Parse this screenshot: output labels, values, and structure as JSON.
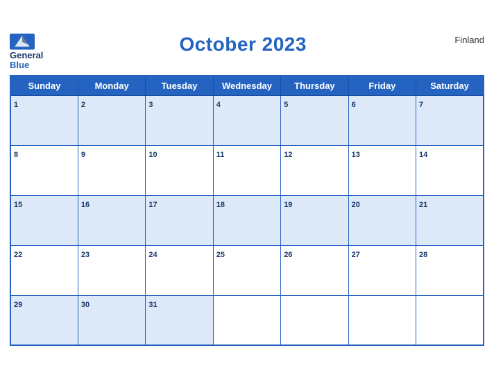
{
  "header": {
    "logo_general": "General",
    "logo_blue": "Blue",
    "title": "October 2023",
    "country": "Finland"
  },
  "weekdays": [
    "Sunday",
    "Monday",
    "Tuesday",
    "Wednesday",
    "Thursday",
    "Friday",
    "Saturday"
  ],
  "weeks": [
    [
      {
        "day": "1",
        "empty": false
      },
      {
        "day": "2",
        "empty": false
      },
      {
        "day": "3",
        "empty": false
      },
      {
        "day": "4",
        "empty": false
      },
      {
        "day": "5",
        "empty": false
      },
      {
        "day": "6",
        "empty": false
      },
      {
        "day": "7",
        "empty": false
      }
    ],
    [
      {
        "day": "8",
        "empty": false
      },
      {
        "day": "9",
        "empty": false
      },
      {
        "day": "10",
        "empty": false
      },
      {
        "day": "11",
        "empty": false
      },
      {
        "day": "12",
        "empty": false
      },
      {
        "day": "13",
        "empty": false
      },
      {
        "day": "14",
        "empty": false
      }
    ],
    [
      {
        "day": "15",
        "empty": false
      },
      {
        "day": "16",
        "empty": false
      },
      {
        "day": "17",
        "empty": false
      },
      {
        "day": "18",
        "empty": false
      },
      {
        "day": "19",
        "empty": false
      },
      {
        "day": "20",
        "empty": false
      },
      {
        "day": "21",
        "empty": false
      }
    ],
    [
      {
        "day": "22",
        "empty": false
      },
      {
        "day": "23",
        "empty": false
      },
      {
        "day": "24",
        "empty": false
      },
      {
        "day": "25",
        "empty": false
      },
      {
        "day": "26",
        "empty": false
      },
      {
        "day": "27",
        "empty": false
      },
      {
        "day": "28",
        "empty": false
      }
    ],
    [
      {
        "day": "29",
        "empty": false
      },
      {
        "day": "30",
        "empty": false
      },
      {
        "day": "31",
        "empty": false
      },
      {
        "day": "",
        "empty": true
      },
      {
        "day": "",
        "empty": true
      },
      {
        "day": "",
        "empty": true
      },
      {
        "day": "",
        "empty": true
      }
    ]
  ]
}
